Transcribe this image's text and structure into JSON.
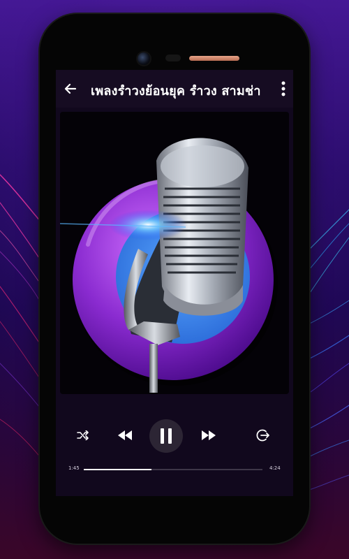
{
  "header": {
    "title": "เพลงรำวงย้อนยุค รำวง สามช่า",
    "back_icon": "arrow-left-icon",
    "menu_icon": "more-vert-icon"
  },
  "artwork": {
    "icon": "microphone-icon",
    "favorite_icon": "heart-outline-icon",
    "ring_color": "#8a2bd0",
    "inner_color": "#3a8ef0"
  },
  "controls": {
    "shuffle_icon": "shuffle-icon",
    "rewind_icon": "rewind-icon",
    "play_pause_icon": "pause-icon",
    "forward_icon": "fast-forward-icon",
    "exit_icon": "exit-icon"
  },
  "progress": {
    "elapsed": "1:45",
    "duration": "4:24",
    "fraction": 0.38
  },
  "colors": {
    "background": "#11081d",
    "accent": "#ffffff"
  }
}
